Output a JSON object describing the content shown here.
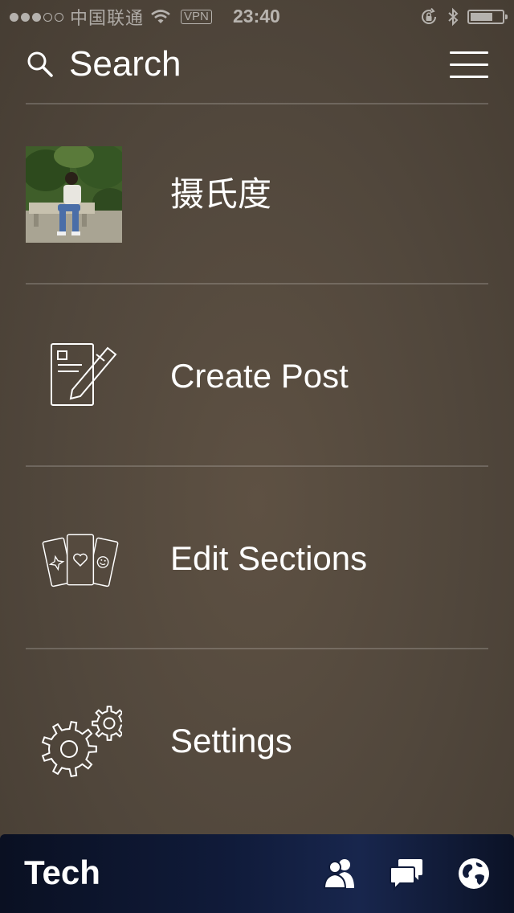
{
  "status_bar": {
    "signal_dots_filled": 3,
    "signal_dots_total": 5,
    "carrier": "中国联通",
    "vpn": "VPN",
    "time": "23:40",
    "battery_level": 0.72,
    "icons": [
      "wifi-icon",
      "rotation-lock-icon",
      "bluetooth-icon",
      "battery-icon"
    ]
  },
  "header": {
    "search_label": "Search",
    "search_icon": "search-icon",
    "menu_icon": "hamburger-menu-icon"
  },
  "menu": {
    "profile": {
      "name": "摄氏度",
      "avatar": "profile-photo"
    },
    "create_post": {
      "label": "Create Post",
      "icon": "compose-icon"
    },
    "edit_sections": {
      "label": "Edit Sections",
      "icon": "section-cards-icon"
    },
    "settings": {
      "label": "Settings",
      "icon": "gears-icon"
    }
  },
  "tab_bar": {
    "section_title": "Tech",
    "icons": [
      "people-icon",
      "chat-bubbles-icon",
      "globe-icon"
    ]
  },
  "colors": {
    "background": "#554a3e",
    "tab_bar": "#0f1a38",
    "text": "#ffffff"
  }
}
